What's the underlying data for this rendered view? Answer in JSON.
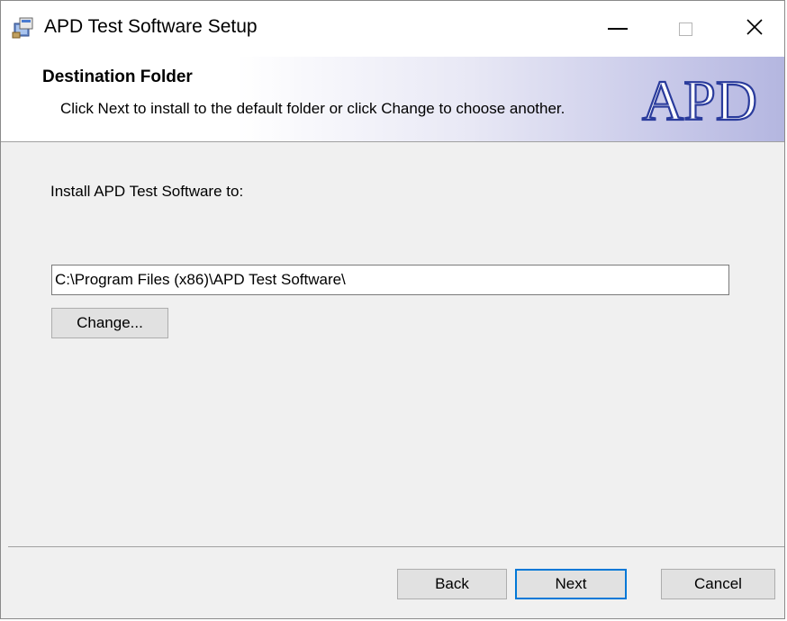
{
  "window": {
    "title": "APD Test Software Setup"
  },
  "icons": {
    "app": "installer-icon",
    "minimize": "minimize-icon",
    "maximize": "maximize-icon",
    "close": "close-icon",
    "logo": "apd-logo"
  },
  "banner": {
    "title": "Destination Folder",
    "description": "Click Next to install to the default folder or click Change to choose another.",
    "logo_text": "APD"
  },
  "main": {
    "install_label": "Install APD Test Software to:",
    "path_value": "C:\\Program Files (x86)\\APD Test Software\\",
    "change_label": "Change..."
  },
  "footer": {
    "back_label": "Back",
    "next_label": "Next",
    "cancel_label": "Cancel"
  },
  "colors": {
    "banner_gradient_end": "#b4b6e0",
    "logo_color": "#2a3b9c",
    "focus_border": "#0078d7",
    "dialog_background": "#f0f0f0"
  }
}
